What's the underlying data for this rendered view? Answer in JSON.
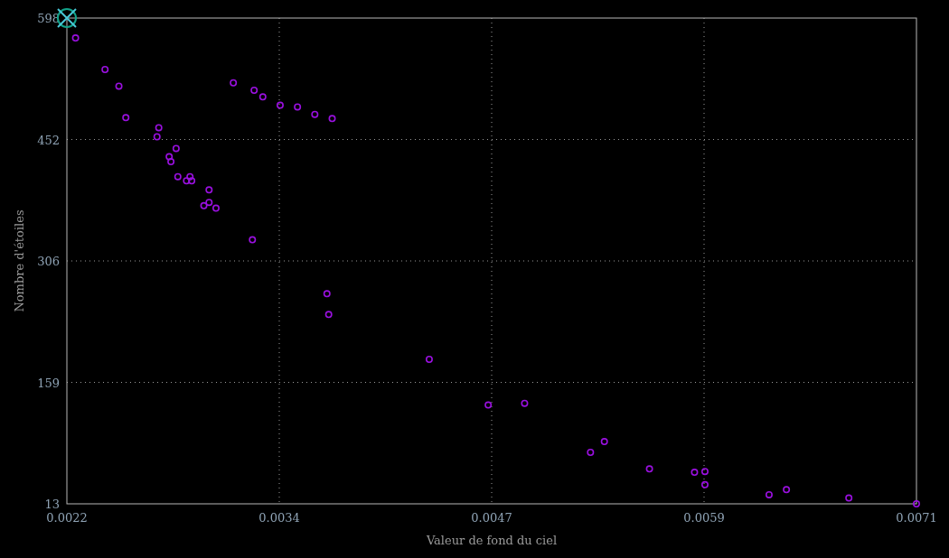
{
  "chart_data": {
    "type": "scatter",
    "xlabel": "Valeur de fond du ciel",
    "ylabel": "Nombre d'étoiles",
    "xlim": [
      0.0022,
      0.0071
    ],
    "ylim": [
      13,
      598
    ],
    "xticks": [
      {
        "value": 0.0022,
        "label": "0.0022"
      },
      {
        "value": 0.003425,
        "label": "0.0034"
      },
      {
        "value": 0.00465,
        "label": "0.0047"
      },
      {
        "value": 0.005875,
        "label": "0.0059"
      },
      {
        "value": 0.0071,
        "label": "0.0071"
      }
    ],
    "yticks": [
      {
        "value": 13,
        "label": "13"
      },
      {
        "value": 159.25,
        "label": "159"
      },
      {
        "value": 305.5,
        "label": "306"
      },
      {
        "value": 451.75,
        "label": "452"
      },
      {
        "value": 598,
        "label": "598"
      }
    ],
    "x": [
      0.00225,
      0.00242,
      0.0025,
      0.00254,
      0.00273,
      0.00272,
      0.00283,
      0.00279,
      0.0028,
      0.00284,
      0.00289,
      0.00291,
      0.00292,
      0.00302,
      0.00302,
      0.00299,
      0.00306,
      0.00316,
      0.00328,
      0.00333,
      0.00327,
      0.00343,
      0.00353,
      0.00363,
      0.00373,
      0.0037,
      0.00371,
      0.00429,
      0.00463,
      0.00484,
      0.00522,
      0.0053,
      0.00556,
      0.00582,
      0.00588,
      0.00588,
      0.00625,
      0.00635,
      0.00671,
      0.0071
    ],
    "series": [
      {
        "color": "#9a10e0",
        "values": [
          574,
          536,
          516,
          478,
          466,
          455,
          441,
          431,
          425,
          407,
          402,
          407,
          402,
          391,
          376,
          372,
          369,
          520,
          511,
          503,
          331,
          493,
          491,
          482,
          477,
          266,
          241,
          187,
          132,
          134,
          75,
          88,
          55,
          51,
          52,
          36,
          24,
          30,
          20,
          13
        ]
      }
    ],
    "grid": true
  },
  "cursor_marker": {
    "shown": true
  }
}
